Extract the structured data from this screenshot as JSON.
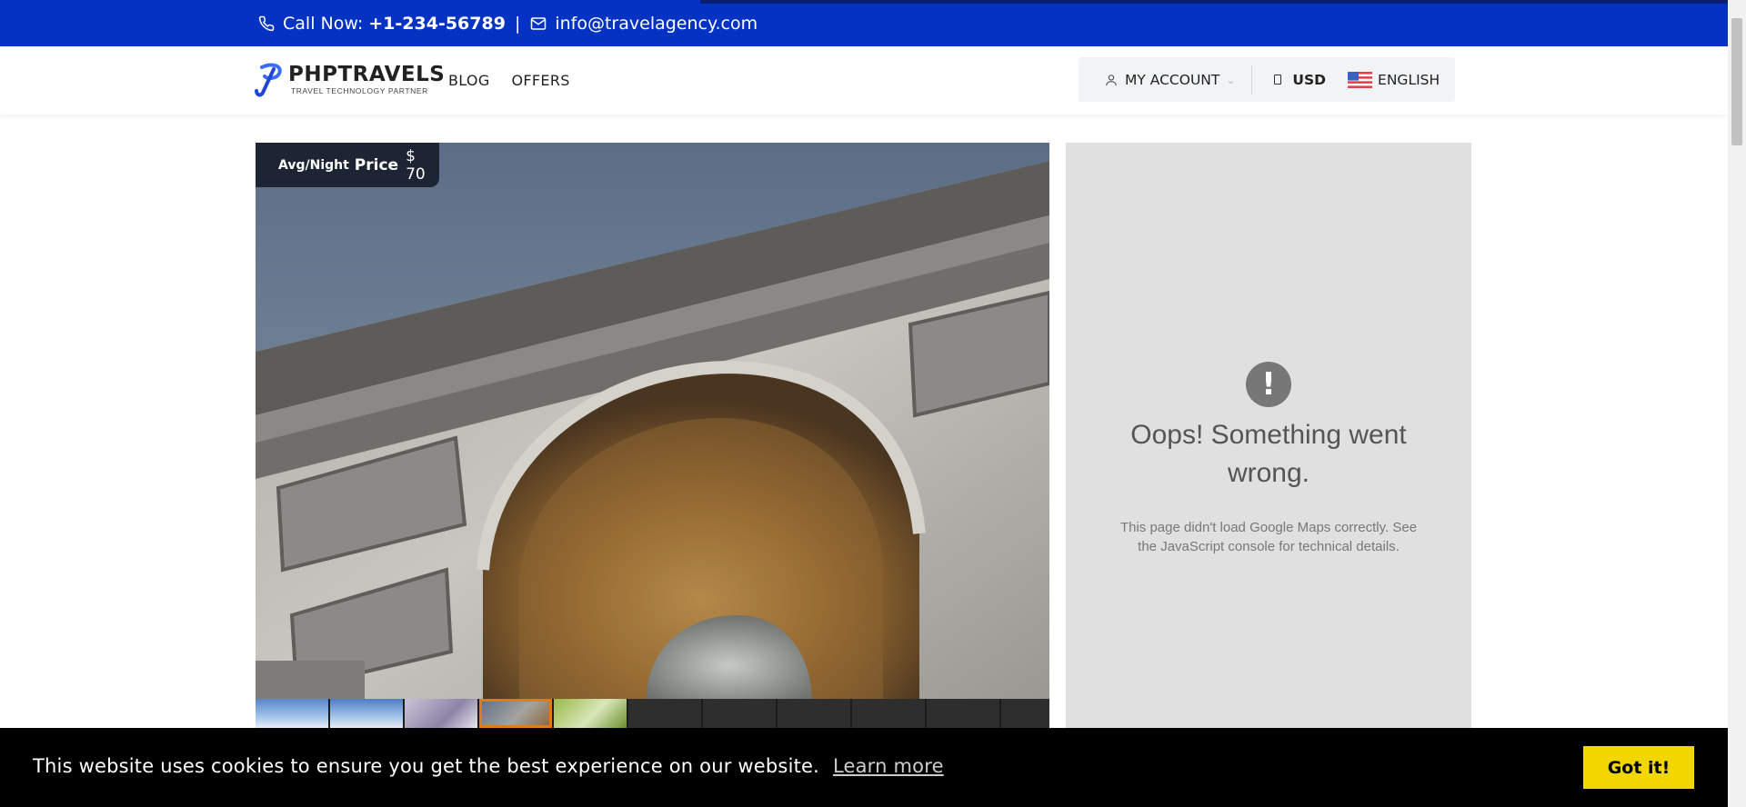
{
  "topbar": {
    "call_label": "Call Now:",
    "phone": "+1-234-56789",
    "separator": "|",
    "email": "info@travelagency.com"
  },
  "header": {
    "logo_name": "PHPTRAVELS",
    "logo_tagline": "TRAVEL TECHNOLOGY PARTNER",
    "nav": [
      "BLOG",
      "OFFERS"
    ],
    "account_label": "MY ACCOUNT",
    "currency": "USD",
    "language": "ENGLISH"
  },
  "gallery": {
    "price_prefix": "Avg/Night",
    "price_label": "Price",
    "price_value": "$ 70",
    "thumbnail_count": 11,
    "active_thumbnail": 4
  },
  "map": {
    "icon_glyph": "!",
    "error_title": "Oops! Something went wrong.",
    "error_desc": "This page didn't load Google Maps correctly. See the JavaScript console for technical details."
  },
  "cookie": {
    "message": "This website uses cookies to ensure you get the best experience on our website.",
    "learn_more": "Learn more",
    "accept": "Got it!"
  },
  "colors": {
    "topbar": "#0433c4",
    "badge": "#1d2433",
    "cookie_button": "#f1d600",
    "active_thumb": "#e07b1a"
  },
  "icons": [
    "phone-icon",
    "mail-icon",
    "user-icon",
    "chevron-down-icon",
    "currency-icon",
    "us-flag-icon",
    "error-icon"
  ]
}
